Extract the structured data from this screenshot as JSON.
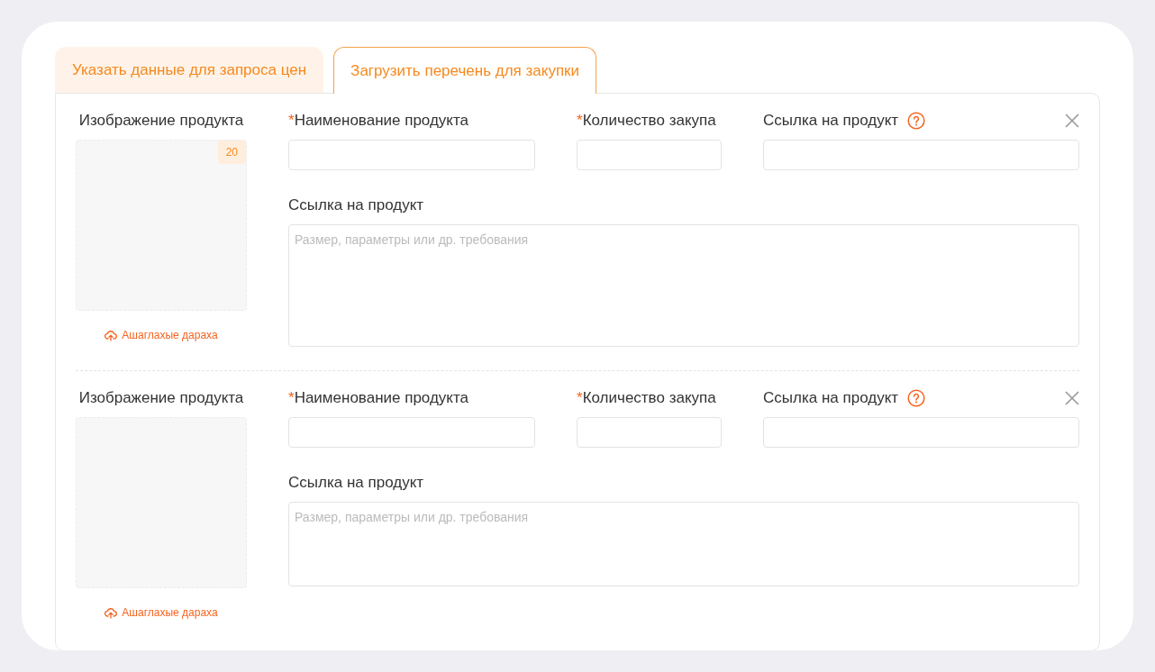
{
  "tabs": [
    {
      "label": "Указать данные для запроса цен",
      "selected": false
    },
    {
      "label": "Загрузить перечень для закупки",
      "selected": true
    }
  ],
  "items": [
    {
      "image_label": "Изображение продукта",
      "badge": "20",
      "upload": "Ашаглахые дараха",
      "fields": [
        {
          "marker": "*",
          "label": "Наименование продукта"
        },
        {
          "marker": "*",
          "label": "Количество закупа"
        },
        {
          "label": "Ссылка на продукт",
          "help": true
        }
      ],
      "note": {
        "label": "Ссылка на продукт",
        "placeholder": "Размер, параметры или др. требования"
      }
    },
    {
      "image_label": "Изображение продукта",
      "upload": "Ашаглахые дараха",
      "fields": [
        {
          "marker": "*",
          "label": "Наименование продукта"
        },
        {
          "marker": "*",
          "label": "Количество закупа"
        },
        {
          "label": "Ссылка на продукт",
          "help": true
        }
      ],
      "note": {
        "label": "Ссылка на продукт",
        "placeholder": "Размер, параметры или др. требования"
      }
    }
  ]
}
